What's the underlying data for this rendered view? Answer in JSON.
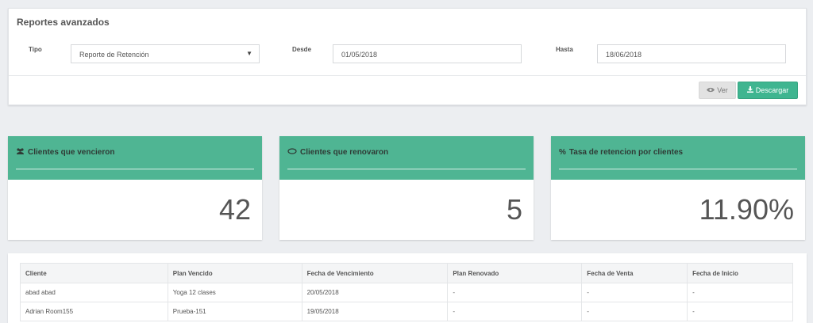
{
  "filters": {
    "title": "Reportes avanzados",
    "tipo_label": "Tipo",
    "tipo_value": "Reporte de Retención",
    "desde_label": "Desde",
    "desde_value": "01/05/2018",
    "hasta_label": "Hasta",
    "hasta_value": "18/06/2018",
    "ver_label": "Ver",
    "descargar_label": "Descargar"
  },
  "cards": [
    {
      "title": "Clientes que vencieron",
      "value": "42",
      "icon": "users-icon"
    },
    {
      "title": "Clientes que renovaron",
      "value": "5",
      "icon": "refresh-icon"
    },
    {
      "title": "Tasa de retencion por clientes",
      "value": "11.90%",
      "icon": "percent-icon"
    }
  ],
  "table": {
    "headers": [
      "Cliente",
      "Plan Vencido",
      "Fecha de Vencimiento",
      "Plan Renovado",
      "Fecha de Venta",
      "Fecha de Inicio"
    ],
    "rows": [
      [
        "abad abad",
        "Yoga 12 clases",
        "20/05/2018",
        "-",
        "-",
        "-"
      ],
      [
        "Adrian Room155",
        "Prueba-151",
        "19/05/2018",
        "-",
        "-",
        "-"
      ]
    ]
  },
  "colors": {
    "accent": "#4fb593",
    "button_green": "#3fb590"
  }
}
